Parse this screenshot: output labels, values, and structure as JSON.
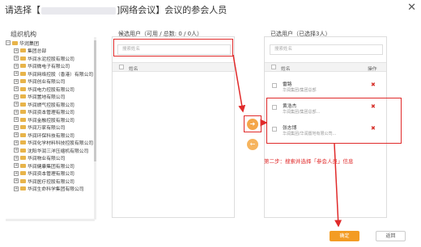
{
  "header": {
    "title_prefix": "请选择【",
    "title_suffix": "]网络会议】会议的参会人员",
    "close_glyph": "✕"
  },
  "org": {
    "title": "组织机构",
    "root": "华润集团",
    "children": [
      "集团总部",
      "华润水泥控股有限公司",
      "华润微电子有限公司",
      "华润网络控股（香港）有限公司",
      "华润创业有限公司",
      "华润电力控股有限公司",
      "华润置地有限公司",
      "华润燃气控股有限公司",
      "华润资本管理有限公司",
      "华润金融控股有限公司",
      "华润万家有限公司",
      "华润环保科技有限公司",
      "华润化学材料科技控股有限公司",
      "沈阳华润三洋压缩机有限公司",
      "华润物业有限公司",
      "华润健康集团有限公司",
      "华润资本管理有限公司",
      "华润医疗控股有限公司",
      "华润生命科学集团有限公司"
    ]
  },
  "candidates": {
    "title": "候选用户（可用 / 总数: 0 / 0人）",
    "search_placeholder": "搜索姓名",
    "col_name": "姓名"
  },
  "selected": {
    "title": "已选用户（已选择3人）",
    "search_placeholder": "搜索姓名",
    "col_name": "姓名",
    "col_op": "操作",
    "users": [
      {
        "name": "雷路",
        "dept": "华润集团/集团总部"
      },
      {
        "name": "黄浩杰",
        "dept": "华润集团/集团总部..."
      },
      {
        "name": "张志博",
        "dept": "华润集团/华润置地有限公司..."
      }
    ],
    "delete_glyph": "✖"
  },
  "transfer": {
    "add_glyph": "➜",
    "remove_glyph": "←"
  },
  "annotation": {
    "step2": "第二步：搜索并选择「参会人员」信息"
  },
  "footer": {
    "ok_label": "确定",
    "back_label": "返回"
  }
}
